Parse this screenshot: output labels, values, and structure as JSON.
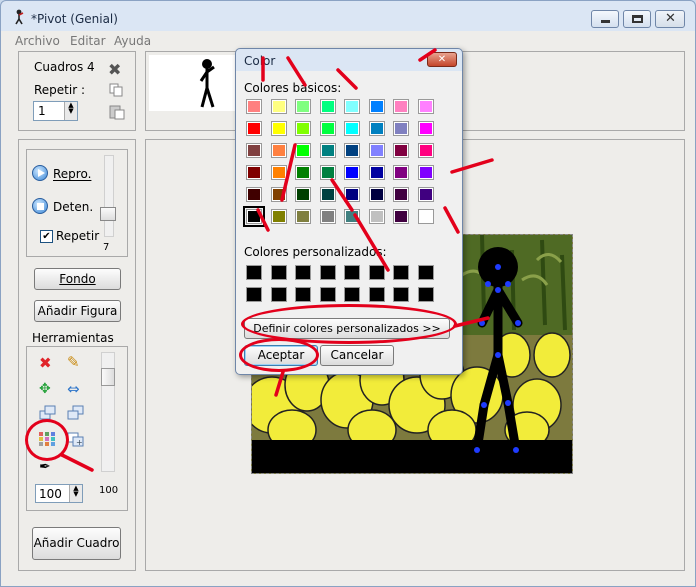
{
  "window": {
    "title": "*Pivot (Genial)"
  },
  "menu": [
    "Archivo",
    "Editar",
    "Ayuda"
  ],
  "frames_panel": {
    "label": "Cuadros 4",
    "repeat_label": "Repetir :",
    "repeat_value": "1"
  },
  "playback": {
    "play_label": "Repro.",
    "stop_label": "Deten.",
    "repeat_label": "Repetir",
    "repeat_checked": true,
    "speed_value": "7"
  },
  "buttons": {
    "background": "Fondo",
    "add_figure": "Añadir Figura",
    "add_frame": "Añadir Cuadro"
  },
  "tools": {
    "label": "Herramientas",
    "zoom_value": "100",
    "scale_label": "100"
  },
  "color_dialog": {
    "title": "Color",
    "basic_label": "Colores básicos:",
    "custom_label": "Colores personalizados:",
    "define_button": "Definir colores personalizados >>",
    "ok_button": "Aceptar",
    "cancel_button": "Cancelar",
    "basic_colors": [
      "#ff8080",
      "#ffff80",
      "#80ff80",
      "#00ff80",
      "#80ffff",
      "#0080ff",
      "#ff80c0",
      "#ff80ff",
      "#ff0000",
      "#ffff00",
      "#80ff00",
      "#00ff40",
      "#00ffff",
      "#0080c0",
      "#8080c0",
      "#ff00ff",
      "#804040",
      "#ff8040",
      "#00ff00",
      "#008080",
      "#004080",
      "#8080ff",
      "#800040",
      "#ff0080",
      "#800000",
      "#ff8000",
      "#008000",
      "#008040",
      "#0000ff",
      "#0000a0",
      "#800080",
      "#8000ff",
      "#400000",
      "#804000",
      "#004000",
      "#004040",
      "#000080",
      "#000040",
      "#400040",
      "#400080",
      "#000000",
      "#808000",
      "#808040",
      "#808080",
      "#408080",
      "#c0c0c0",
      "#400040",
      "#ffffff"
    ],
    "selected_index": 40,
    "custom_colors": [
      "#000000",
      "#000000",
      "#000000",
      "#000000",
      "#000000",
      "#000000",
      "#000000",
      "#000000",
      "#000000",
      "#000000",
      "#000000",
      "#000000",
      "#000000",
      "#000000",
      "#000000",
      "#000000"
    ]
  },
  "colors": {
    "annotation_red": "#e3001b",
    "stick_blue": "#1f3cff"
  }
}
